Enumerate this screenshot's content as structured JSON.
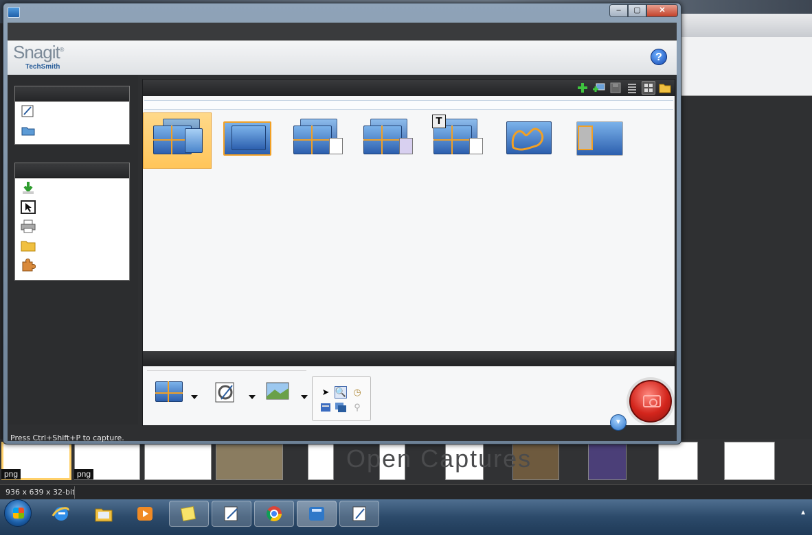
{
  "window": {
    "title_buttons": {
      "minimize": "‒",
      "maximize": "▢",
      "close": "✕"
    }
  },
  "brand": {
    "logo": "Snagit",
    "logo_mark": "®",
    "sub": "TechSmith"
  },
  "help": {
    "label": "?"
  },
  "main": {
    "status": "Press  Ctrl+Shift+P  to capture."
  },
  "filmstrip": {
    "background_text": "Open Captures",
    "tags": [
      "png",
      "png"
    ]
  },
  "infobar": {
    "dimensions": "936 x 639 x 32-bit"
  },
  "icons": {
    "toolbar": [
      "add-icon",
      "add-profile-icon",
      "save-icon",
      "list-view-icon",
      "grid-view-icon",
      "folder-icon"
    ],
    "quick_launch": [
      "editor-icon",
      "open-folder-icon"
    ],
    "related_tasks": [
      "download-icon",
      "cursor-icon",
      "print-icon",
      "folder-icon",
      "puzzle-icon"
    ]
  },
  "colors": {
    "accent": "#ffc55a",
    "capture": "#d3251c",
    "brand_blue": "#2b5f9a"
  }
}
